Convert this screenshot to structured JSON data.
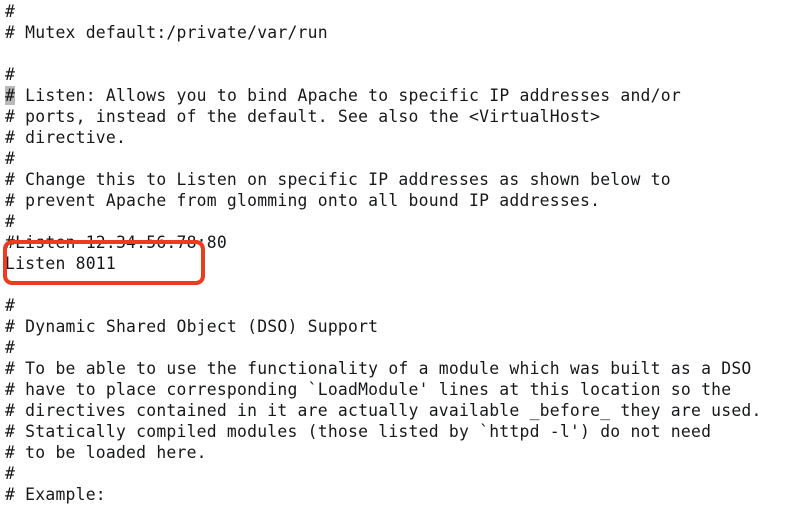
{
  "document": {
    "kind": "apache-httpd-conf",
    "background_color": "#ffffff",
    "text_color": "#16181a",
    "lines": [
      {
        "id": "l01",
        "text": "#"
      },
      {
        "id": "l02",
        "text": "# Mutex default:/private/var/run"
      },
      {
        "id": "l03",
        "text": ""
      },
      {
        "id": "l04",
        "text": "#"
      },
      {
        "id": "l05",
        "text": "# Listen: Allows you to bind Apache to specific IP addresses and/or",
        "highlight_char": "#",
        "highlight_rest": " Listen: Allows you to bind Apache to specific IP addresses and/or"
      },
      {
        "id": "l06",
        "text": "# ports, instead of the default. See also the <VirtualHost>"
      },
      {
        "id": "l07",
        "text": "# directive."
      },
      {
        "id": "l08",
        "text": "#"
      },
      {
        "id": "l09",
        "text": "# Change this to Listen on specific IP addresses as shown below to"
      },
      {
        "id": "l10",
        "text": "# prevent Apache from glomming onto all bound IP addresses."
      },
      {
        "id": "l11",
        "text": "#"
      },
      {
        "id": "l12",
        "text": "#Listen 12.34.56.78:80"
      },
      {
        "id": "l13",
        "text": "Listen 8011"
      },
      {
        "id": "l14",
        "text": ""
      },
      {
        "id": "l15",
        "text": "#"
      },
      {
        "id": "l16",
        "text": "# Dynamic Shared Object (DSO) Support"
      },
      {
        "id": "l17",
        "text": "#"
      },
      {
        "id": "l18",
        "text": "# To be able to use the functionality of a module which was built as a DSO"
      },
      {
        "id": "l19",
        "text": "# have to place corresponding `LoadModule' lines at this location so the"
      },
      {
        "id": "l20",
        "text": "# directives contained in it are actually available _before_ they are used."
      },
      {
        "id": "l21",
        "text": "# Statically compiled modules (those listed by `httpd -l') do not need"
      },
      {
        "id": "l22",
        "text": "# to be loaded here."
      },
      {
        "id": "l23",
        "text": "#"
      },
      {
        "id": "l24",
        "text": "# Example:"
      }
    ]
  },
  "selection": {
    "selected_text": "#",
    "highlight_color": "#b9b9b9"
  },
  "annotation": {
    "shape": "rounded-rectangle",
    "color": "#ee3a1e",
    "encloses": "Listen 8011"
  }
}
